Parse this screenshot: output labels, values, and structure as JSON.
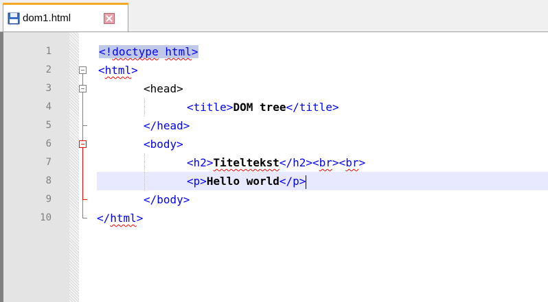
{
  "tab": {
    "filename": "dom1.html",
    "icon": "save-file-icon",
    "close_icon": "close-icon"
  },
  "lines": [
    {
      "n": "1",
      "code": "<!doctype html>"
    },
    {
      "n": "2",
      "code": "<html>"
    },
    {
      "n": "3",
      "code": "<head>"
    },
    {
      "n": "4",
      "code": "<title>DOM tree</title>"
    },
    {
      "n": "5",
      "code": "</head>"
    },
    {
      "n": "6",
      "code": "<body>"
    },
    {
      "n": "7",
      "code": "<h2>Titeltekst</h2><br><br>"
    },
    {
      "n": "8",
      "code": "<p>Hello world</p>"
    },
    {
      "n": "9",
      "code": "</body>"
    },
    {
      "n": "10",
      "code": "</html>"
    }
  ],
  "colors": {
    "tag": "#0000ff",
    "text": "#000000",
    "current_line": "#e8e8ff",
    "fold_active": "#ff0000",
    "fold_inactive": "#808080",
    "tab_accent": "#f5a623"
  }
}
